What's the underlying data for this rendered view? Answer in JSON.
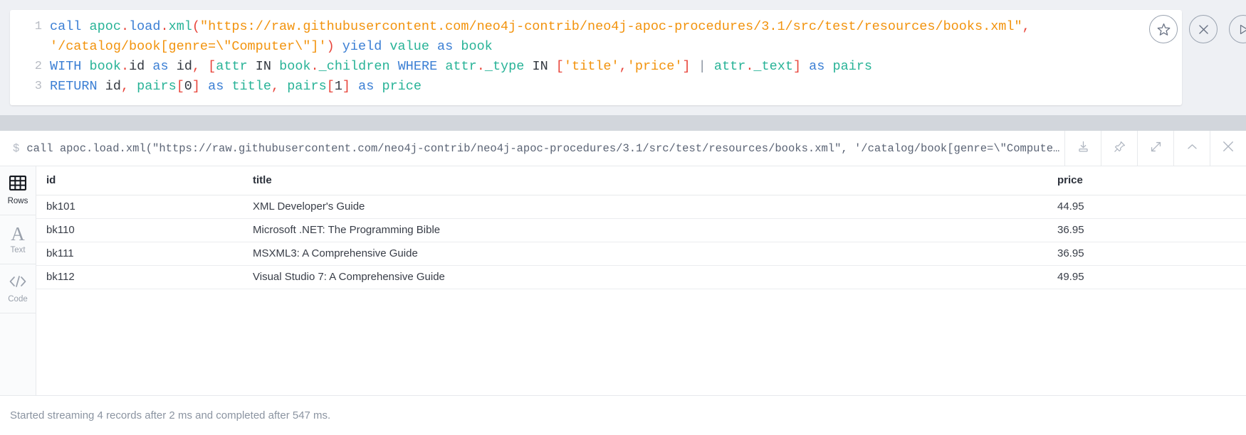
{
  "editor": {
    "lines": [
      {
        "num": "1",
        "tokens": [
          {
            "t": "call",
            "c": "kw"
          },
          {
            "t": " ",
            "c": "var"
          },
          {
            "t": "apoc",
            "c": "fn"
          },
          {
            "t": ".",
            "c": "punc"
          },
          {
            "t": "load",
            "c": "kw"
          },
          {
            "t": ".",
            "c": "punc"
          },
          {
            "t": "xml",
            "c": "fn"
          },
          {
            "t": "(",
            "c": "punc"
          },
          {
            "t": "\"https://raw.githubusercontent.com/neo4j-contrib/neo4j-apoc-procedures/3.1/src/test/resources/books.xml\"",
            "c": "str"
          },
          {
            "t": ",",
            "c": "punc"
          }
        ]
      },
      {
        "num": "",
        "tokens": [
          {
            "t": "'/catalog/book[genre=\\\"Computer\\\"]'",
            "c": "str"
          },
          {
            "t": ")",
            "c": "punc"
          },
          {
            "t": " ",
            "c": "var"
          },
          {
            "t": "yield",
            "c": "kw"
          },
          {
            "t": " ",
            "c": "var"
          },
          {
            "t": "value",
            "c": "fn"
          },
          {
            "t": " ",
            "c": "var"
          },
          {
            "t": "as",
            "c": "kw"
          },
          {
            "t": " ",
            "c": "var"
          },
          {
            "t": "book",
            "c": "fn"
          }
        ]
      },
      {
        "num": "2",
        "tokens": [
          {
            "t": "WITH",
            "c": "kw"
          },
          {
            "t": " ",
            "c": "var"
          },
          {
            "t": "book",
            "c": "fn"
          },
          {
            "t": ".",
            "c": "punc"
          },
          {
            "t": "id",
            "c": "var"
          },
          {
            "t": " ",
            "c": "var"
          },
          {
            "t": "as",
            "c": "kw"
          },
          {
            "t": " ",
            "c": "var"
          },
          {
            "t": "id",
            "c": "var"
          },
          {
            "t": ",",
            "c": "punc"
          },
          {
            "t": " ",
            "c": "var"
          },
          {
            "t": "[",
            "c": "punc"
          },
          {
            "t": "attr",
            "c": "fn"
          },
          {
            "t": " ",
            "c": "var"
          },
          {
            "t": "IN",
            "c": "op"
          },
          {
            "t": " ",
            "c": "var"
          },
          {
            "t": "book",
            "c": "fn"
          },
          {
            "t": ".",
            "c": "punc"
          },
          {
            "t": "_children",
            "c": "fn"
          },
          {
            "t": " ",
            "c": "var"
          },
          {
            "t": "WHERE",
            "c": "kw"
          },
          {
            "t": " ",
            "c": "var"
          },
          {
            "t": "attr",
            "c": "fn"
          },
          {
            "t": ".",
            "c": "punc"
          },
          {
            "t": "_type",
            "c": "fn"
          },
          {
            "t": " ",
            "c": "var"
          },
          {
            "t": "IN",
            "c": "op"
          },
          {
            "t": " ",
            "c": "var"
          },
          {
            "t": "[",
            "c": "punc"
          },
          {
            "t": "'title'",
            "c": "str"
          },
          {
            "t": ",",
            "c": "punc"
          },
          {
            "t": "'price'",
            "c": "str"
          },
          {
            "t": "]",
            "c": "punc"
          },
          {
            "t": " ",
            "c": "var"
          },
          {
            "t": "|",
            "c": "pipe"
          },
          {
            "t": " ",
            "c": "var"
          },
          {
            "t": "attr",
            "c": "fn"
          },
          {
            "t": ".",
            "c": "punc"
          },
          {
            "t": "_text",
            "c": "fn"
          },
          {
            "t": "]",
            "c": "punc"
          },
          {
            "t": " ",
            "c": "var"
          },
          {
            "t": "as",
            "c": "kw"
          },
          {
            "t": " ",
            "c": "var"
          },
          {
            "t": "pairs",
            "c": "fn"
          }
        ]
      },
      {
        "num": "3",
        "tokens": [
          {
            "t": "RETURN",
            "c": "kw"
          },
          {
            "t": " ",
            "c": "var"
          },
          {
            "t": "id",
            "c": "var"
          },
          {
            "t": ",",
            "c": "punc"
          },
          {
            "t": " ",
            "c": "var"
          },
          {
            "t": "pairs",
            "c": "fn"
          },
          {
            "t": "[",
            "c": "punc"
          },
          {
            "t": "0",
            "c": "var"
          },
          {
            "t": "]",
            "c": "punc"
          },
          {
            "t": " ",
            "c": "var"
          },
          {
            "t": "as",
            "c": "kw"
          },
          {
            "t": " ",
            "c": "var"
          },
          {
            "t": "title",
            "c": "fn"
          },
          {
            "t": ",",
            "c": "punc"
          },
          {
            "t": " ",
            "c": "var"
          },
          {
            "t": "pairs",
            "c": "fn"
          },
          {
            "t": "[",
            "c": "punc"
          },
          {
            "t": "1",
            "c": "var"
          },
          {
            "t": "]",
            "c": "punc"
          },
          {
            "t": " ",
            "c": "var"
          },
          {
            "t": "as",
            "c": "kw"
          },
          {
            "t": " ",
            "c": "var"
          },
          {
            "t": "price",
            "c": "fn"
          }
        ]
      }
    ],
    "controls": [
      {
        "name": "favorite-button",
        "icon": "star-icon"
      },
      {
        "name": "close-editor-button",
        "icon": "close-icon"
      },
      {
        "name": "run-query-button",
        "icon": "play-icon"
      }
    ]
  },
  "prompt": {
    "symbol": "$",
    "command": "call apoc.load.xml(\"https://raw.githubusercontent.com/neo4j-contrib/neo4j-apoc-procedures/3.1/src/test/resources/books.xml\", '/catalog/book[genre=\\\"Compute…",
    "actions": [
      {
        "name": "download-button",
        "icon": "download-icon"
      },
      {
        "name": "pin-button",
        "icon": "pin-icon"
      },
      {
        "name": "expand-button",
        "icon": "expand-icon"
      },
      {
        "name": "collapse-button",
        "icon": "chevron-up-icon"
      },
      {
        "name": "close-result-button",
        "icon": "close-icon"
      }
    ]
  },
  "view_tabs": [
    {
      "label": "Rows",
      "icon": "table-icon",
      "active": true
    },
    {
      "label": "Text",
      "icon": "text-a-icon",
      "active": false
    },
    {
      "label": "Code",
      "icon": "code-brackets-icon",
      "active": false
    }
  ],
  "table": {
    "columns": [
      "id",
      "title",
      "price"
    ],
    "rows": [
      {
        "id": "bk101",
        "title": "XML Developer's Guide",
        "price": "44.95"
      },
      {
        "id": "bk110",
        "title": "Microsoft .NET: The Programming Bible",
        "price": "36.95"
      },
      {
        "id": "bk111",
        "title": "MSXML3: A Comprehensive Guide",
        "price": "36.95"
      },
      {
        "id": "bk112",
        "title": "Visual Studio 7: A Comprehensive Guide",
        "price": "49.95"
      }
    ]
  },
  "status": {
    "text": "Started streaming 4 records after 2 ms and completed after 547 ms."
  },
  "colors": {
    "background": "#eef0f4",
    "band": "#d2d6dc",
    "card": "#ffffff",
    "keyword": "#3b7fd4",
    "function": "#28b397",
    "punctuation": "#e8443a",
    "string": "#f2930d",
    "variable": "#383d47",
    "muted": "#8b94a1"
  }
}
